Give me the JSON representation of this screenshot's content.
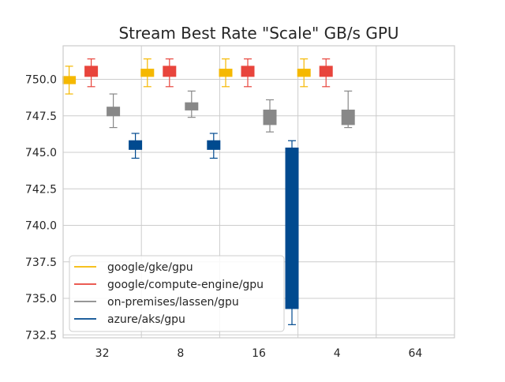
{
  "chart_data": {
    "type": "box",
    "title": "Stream Best Rate \"Scale\" GB/s GPU",
    "xlabel": "",
    "ylabel": "",
    "categories": [
      "32",
      "8",
      "16",
      "4",
      "64"
    ],
    "ylim": [
      732.3,
      752.3
    ],
    "yticks": [
      "732.5",
      "735.0",
      "737.5",
      "740.0",
      "742.5",
      "745.0",
      "747.5",
      "750.0"
    ],
    "grid": true,
    "legend_position": "lower-left",
    "series": [
      {
        "name": "google/gke/gpu",
        "color": "#f5b800",
        "boxes": [
          {
            "category": "32",
            "whisker_low": 749.0,
            "q1": 749.7,
            "median": 749.9,
            "q3": 750.2,
            "whisker_high": 750.9
          },
          {
            "category": "8",
            "whisker_low": 749.5,
            "q1": 750.2,
            "median": 750.4,
            "q3": 750.7,
            "whisker_high": 751.4
          },
          {
            "category": "16",
            "whisker_low": 749.5,
            "q1": 750.2,
            "median": 750.4,
            "q3": 750.7,
            "whisker_high": 751.4
          },
          {
            "category": "4",
            "whisker_low": 749.5,
            "q1": 750.2,
            "median": 750.4,
            "q3": 750.7,
            "whisker_high": 751.4
          }
        ]
      },
      {
        "name": "google/compute-engine/gpu",
        "color": "#e8453c",
        "boxes": [
          {
            "category": "32",
            "whisker_low": 749.5,
            "q1": 750.2,
            "median": 750.5,
            "q3": 750.9,
            "whisker_high": 751.4
          },
          {
            "category": "8",
            "whisker_low": 749.5,
            "q1": 750.2,
            "median": 750.5,
            "q3": 750.9,
            "whisker_high": 751.4
          },
          {
            "category": "16",
            "whisker_low": 749.5,
            "q1": 750.2,
            "median": 750.5,
            "q3": 750.9,
            "whisker_high": 751.4
          },
          {
            "category": "4",
            "whisker_low": 749.5,
            "q1": 750.2,
            "median": 750.5,
            "q3": 750.9,
            "whisker_high": 751.4
          }
        ]
      },
      {
        "name": "on-premises/lassen/gpu",
        "color": "#888888",
        "boxes": [
          {
            "category": "32",
            "whisker_low": 746.7,
            "q1": 747.5,
            "median": 747.8,
            "q3": 748.1,
            "whisker_high": 749.0
          },
          {
            "category": "8",
            "whisker_low": 747.4,
            "q1": 747.9,
            "median": 748.1,
            "q3": 748.4,
            "whisker_high": 749.2
          },
          {
            "category": "16",
            "whisker_low": 746.4,
            "q1": 746.9,
            "median": 747.4,
            "q3": 747.9,
            "whisker_high": 748.6
          },
          {
            "category": "4",
            "whisker_low": 746.7,
            "q1": 746.9,
            "median": 747.4,
            "q3": 747.9,
            "whisker_high": 749.2
          }
        ]
      },
      {
        "name": "azure/aks/gpu",
        "color": "#004a8f",
        "boxes": [
          {
            "category": "32",
            "whisker_low": 744.6,
            "q1": 745.2,
            "median": 745.5,
            "q3": 745.8,
            "whisker_high": 746.3
          },
          {
            "category": "8",
            "whisker_low": 744.6,
            "q1": 745.2,
            "median": 745.5,
            "q3": 745.8,
            "whisker_high": 746.3
          },
          {
            "category": "16",
            "whisker_low": 733.2,
            "q1": 734.3,
            "median": 740.0,
            "q3": 745.3,
            "whisker_high": 745.8
          }
        ]
      }
    ]
  }
}
